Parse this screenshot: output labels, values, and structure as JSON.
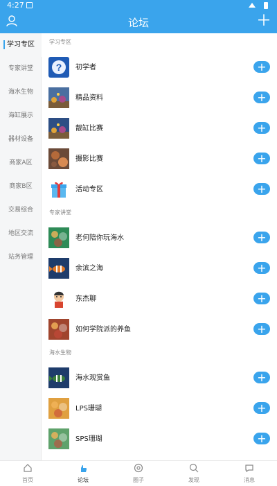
{
  "status_bar": {
    "time": "4:27"
  },
  "header": {
    "title": "论坛"
  },
  "sidebar": {
    "items": [
      {
        "label": "学习专区",
        "active": true
      },
      {
        "label": "专家讲堂"
      },
      {
        "label": "海水生物"
      },
      {
        "label": "海缸展示"
      },
      {
        "label": "器材设备"
      },
      {
        "label": "商家A区"
      },
      {
        "label": "商家B区"
      },
      {
        "label": "交易综合"
      },
      {
        "label": "地区交流"
      },
      {
        "label": "站务管理"
      }
    ]
  },
  "sections": [
    {
      "label": "学习专区",
      "forums": [
        {
          "name": "初学者",
          "icon": "question-icon",
          "color": "#1f5bb5"
        },
        {
          "name": "精品资料",
          "icon": "aquarium-photo",
          "color": "#4a6fa0"
        },
        {
          "name": "靓缸比赛",
          "icon": "aquarium-photo",
          "color": "#2d4e84"
        },
        {
          "name": "摄影比赛",
          "icon": "fish-photo",
          "color": "#b46a3a"
        },
        {
          "name": "活动专区",
          "icon": "gift-icon",
          "color": "#3aa4ec"
        }
      ]
    },
    {
      "label": "专家讲堂",
      "forums": [
        {
          "name": "老何陪你玩海水",
          "icon": "coral-photo",
          "color": "#2e8b57"
        },
        {
          "name": "余滨之海",
          "icon": "clownfish-photo",
          "color": "#e07a2a"
        },
        {
          "name": "东杰聊",
          "icon": "cartoon-avatar",
          "color": "#f0f0f0"
        },
        {
          "name": "如何学院派的养鱼",
          "icon": "coral-photo",
          "color": "#a0452e"
        }
      ]
    },
    {
      "label": "海水生物",
      "forums": [
        {
          "name": "海水观赏鱼",
          "icon": "clownfish-photo",
          "color": "#3a7d3a"
        },
        {
          "name": "LPS珊瑚",
          "icon": "coral-photo",
          "color": "#e0a040"
        },
        {
          "name": "SPS珊瑚",
          "icon": "coral-photo",
          "color": "#5fa26b"
        }
      ]
    }
  ],
  "tabbar": {
    "items": [
      {
        "label": "首页",
        "icon": "home-icon"
      },
      {
        "label": "论坛",
        "icon": "forum-hand-icon",
        "active": true
      },
      {
        "label": "圈子",
        "icon": "circle-icon"
      },
      {
        "label": "发现",
        "icon": "discover-icon"
      },
      {
        "label": "消息",
        "icon": "message-icon"
      }
    ]
  }
}
